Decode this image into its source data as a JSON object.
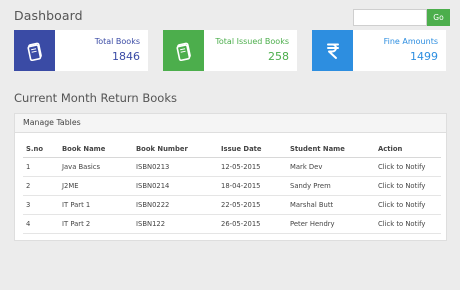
{
  "header": {
    "title": "Dashboard"
  },
  "search": {
    "value": "",
    "placeholder": "",
    "button_label": "Go"
  },
  "stats": [
    {
      "label": "Total Books",
      "value": "1846",
      "color": "#3a4ba5",
      "icon": "book-icon"
    },
    {
      "label": "Total Issued Books",
      "value": "258",
      "color": "#4cae4c",
      "icon": "book-icon"
    },
    {
      "label": "Fine Amounts",
      "value": "1499",
      "color": "#2d8ee0",
      "icon": "rupee-icon"
    }
  ],
  "section": {
    "title": "Current Month Return Books"
  },
  "panel": {
    "heading": "Manage Tables",
    "columns": [
      "S.no",
      "Book Name",
      "Book Number",
      "Issue Date",
      "Student Name",
      "Action"
    ],
    "rows": [
      [
        "1",
        "Java Basics",
        "ISBN0213",
        "12-05-2015",
        "Mark Dev",
        "Click to Notify"
      ],
      [
        "2",
        "J2ME",
        "ISBN0214",
        "18-04-2015",
        "Sandy Prem",
        "Click to Notify"
      ],
      [
        "3",
        "IT Part 1",
        "ISBN0222",
        "22-05-2015",
        "Marshal Butt",
        "Click to Notify"
      ],
      [
        "4",
        "IT Part 2",
        "ISBN122",
        "26-05-2015",
        "Peter Hendry",
        "Click to Notify"
      ]
    ]
  }
}
